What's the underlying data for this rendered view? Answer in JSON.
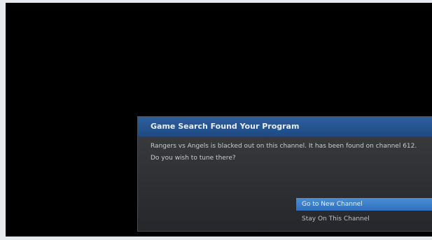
{
  "dialog": {
    "title": "Game Search Found Your Program",
    "message": "Rangers vs Angels is blacked out on this channel. It has been found on channel 612. Do you wish to tune there?",
    "options": [
      {
        "label": "Go to New Channel",
        "selected": true
      },
      {
        "label": "Stay On This Channel",
        "selected": false
      }
    ]
  },
  "colors": {
    "screen_background": "#000000",
    "header_blue": "#2d5f9e",
    "highlight_blue": "#3b7fcc",
    "dialog_background": "#303236"
  }
}
